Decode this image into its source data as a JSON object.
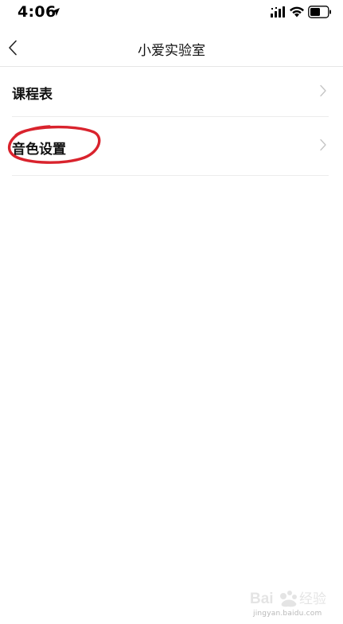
{
  "status_bar": {
    "time": "4:06"
  },
  "nav": {
    "title": "小爱实验室"
  },
  "list": {
    "items": [
      {
        "label": "课程表"
      },
      {
        "label": "音色设置"
      }
    ]
  },
  "annotation": {
    "highlight_color": "#d9232d"
  },
  "watermark": {
    "brand": "Baidu经验",
    "url": "jingyan.baidu.com"
  }
}
